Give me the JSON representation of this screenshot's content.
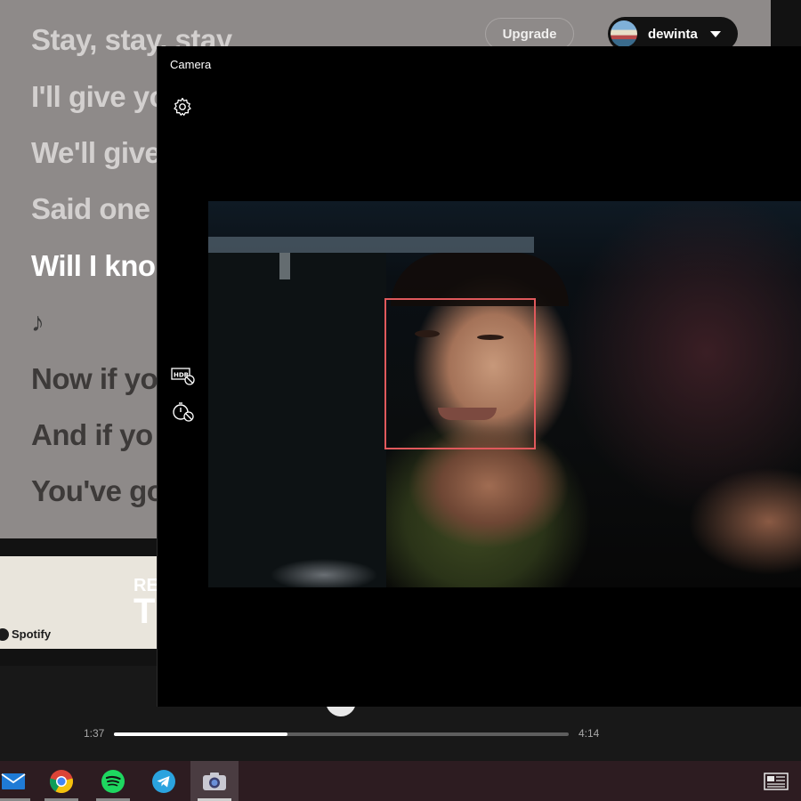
{
  "spotify": {
    "lyrics": [
      "Stay, stay, stay",
      "I'll give yo",
      "We'll give",
      "Said one",
      "Will I kno",
      "♪",
      "Now if yo",
      "And if yo",
      "You've go"
    ],
    "upgrade_label": "Upgrade",
    "username": "dewinta",
    "ad": {
      "small_text": "RE",
      "big_text": "T",
      "brand": "Spotify"
    },
    "player": {
      "elapsed": "1:37",
      "total": "4:14",
      "progress_fraction": 0.382
    }
  },
  "camera": {
    "title": "Camera",
    "settings_icon": "gear-icon",
    "hdr_icon": "hdr-off-icon",
    "timer_icon": "timer-off-icon",
    "face_box_color": "#e0595c"
  },
  "taskbar": {
    "apps": [
      "mail-icon",
      "chrome-icon",
      "spotify-icon",
      "telegram-icon",
      "camera-icon"
    ],
    "active_app": "camera-icon"
  },
  "colors": {
    "lyrics_bg": "#8e8a89",
    "spotify_green": "#1ed760",
    "taskbar_bg": "#2d1c21"
  }
}
